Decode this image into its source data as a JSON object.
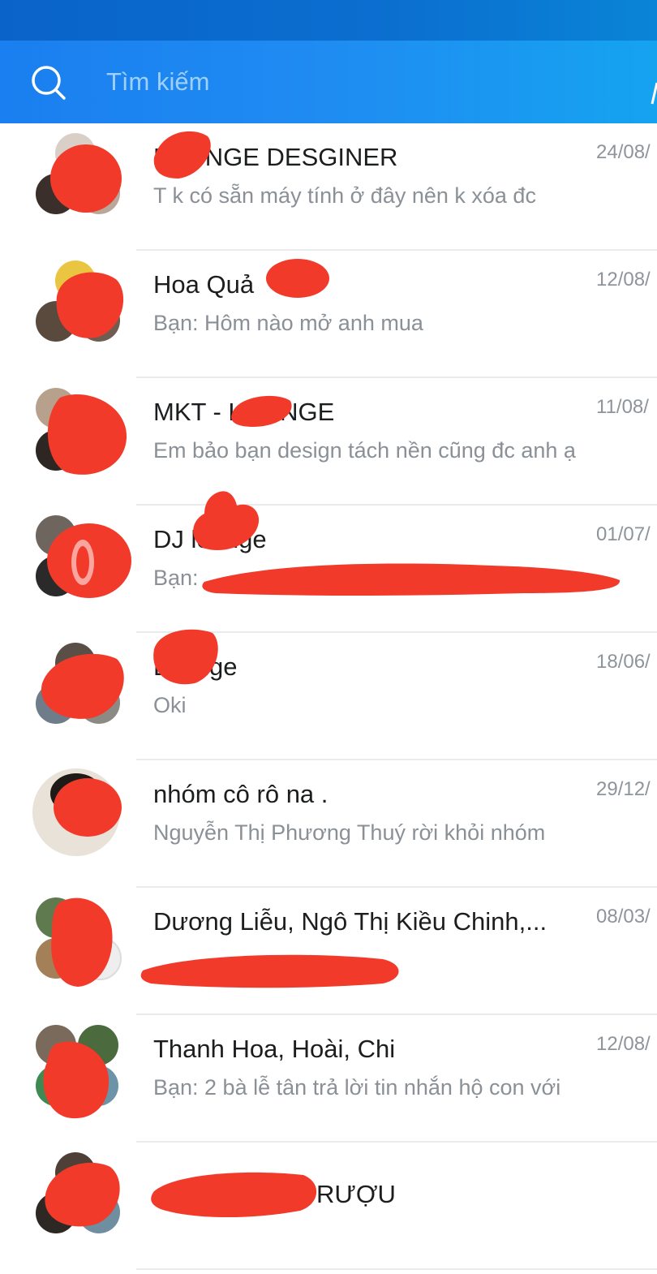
{
  "search": {
    "placeholder": "Tìm kiếm",
    "icon": "search-icon"
  },
  "colors": {
    "header": "#1a7ff0",
    "redaction": "#f23a2b"
  },
  "conversations": [
    {
      "title": "LOUNGE DESGINER",
      "preview": "T k có sẵn máy tính ở đây nên k xóa đc",
      "date": "24/08/"
    },
    {
      "title": "Hoa Quả",
      "preview": "Bạn: Hôm nào mở anh mua",
      "date": "12/08/"
    },
    {
      "title": "MKT - LOUNGE",
      "preview": "Em bảo bạn design tách nền cũng đc anh ạ",
      "date": "11/08/"
    },
    {
      "title": "DJ lounge",
      "preview": "Bạn:",
      "date": "01/07/"
    },
    {
      "title": "Lounge",
      "preview": "Oki",
      "date": "18/06/"
    },
    {
      "title": "nhóm cô rô na .",
      "preview": "Nguyễn Thị Phương Thuý rời khỏi nhóm",
      "date": "29/12/"
    },
    {
      "title": "Dương Liễu, Ngô Thị Kiều Chinh,...",
      "preview": "",
      "date": "08/03/"
    },
    {
      "title": "Thanh Hoa, Hoài, Chi",
      "preview": "Bạn: 2 bà lễ tân trả lời tin nhắn hộ con với",
      "date": "12/08/"
    },
    {
      "title": "RƯỢU",
      "preview": "",
      "date": ""
    }
  ]
}
